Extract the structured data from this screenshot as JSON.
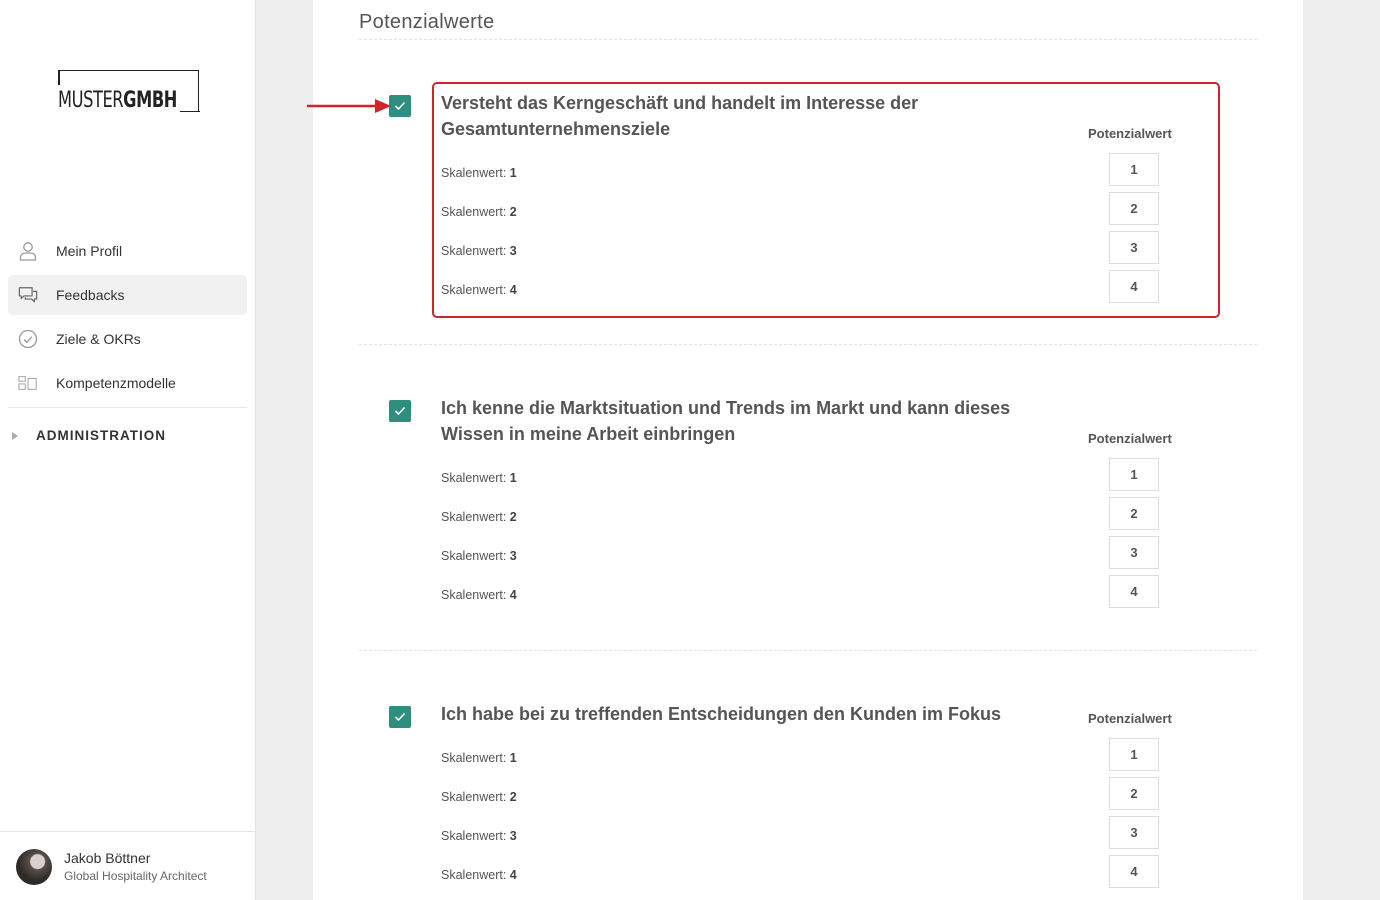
{
  "sidebar": {
    "logo": {
      "part1": "MUSTER",
      "part2": "GMBH"
    },
    "items": [
      {
        "label": "Mein Profil",
        "icon": "user-icon",
        "active": false
      },
      {
        "label": "Feedbacks",
        "icon": "chat-icon",
        "active": true
      },
      {
        "label": "Ziele & OKRs",
        "icon": "check-circle-icon",
        "active": false
      },
      {
        "label": "Kompetenzmodelle",
        "icon": "grid-icon",
        "active": false
      }
    ],
    "admin_label": "ADMINISTRATION",
    "user": {
      "name": "Jakob Böttner",
      "role": "Global Hospitality Architect"
    }
  },
  "main": {
    "section_title": "Potenzialwerte",
    "pot_label": "Potenzialwert",
    "scale_prefix": "Skalenwert:",
    "questions": [
      {
        "title_line1": "Versteht das Kerngeschäft und handelt im Interesse der",
        "title_line2": "Gesamtunternehmensziele",
        "scales": [
          "1",
          "2",
          "3",
          "4"
        ],
        "options": [
          "1",
          "2",
          "3",
          "4"
        ]
      },
      {
        "title_line1": "Ich kenne die Marktsituation und Trends im Markt und kann dieses",
        "title_line2": "Wissen in meine Arbeit einbringen",
        "scales": [
          "1",
          "2",
          "3",
          "4"
        ],
        "options": [
          "1",
          "2",
          "3",
          "4"
        ]
      },
      {
        "title_line1": "Ich habe bei zu treffenden Entscheidungen den Kunden im Fokus",
        "title_line2": "",
        "scales": [
          "1",
          "2",
          "3",
          "4"
        ],
        "options": [
          "1",
          "2",
          "3",
          "4"
        ]
      }
    ]
  },
  "colors": {
    "accent": "#2f8f7e",
    "highlight": "#d2232a"
  }
}
